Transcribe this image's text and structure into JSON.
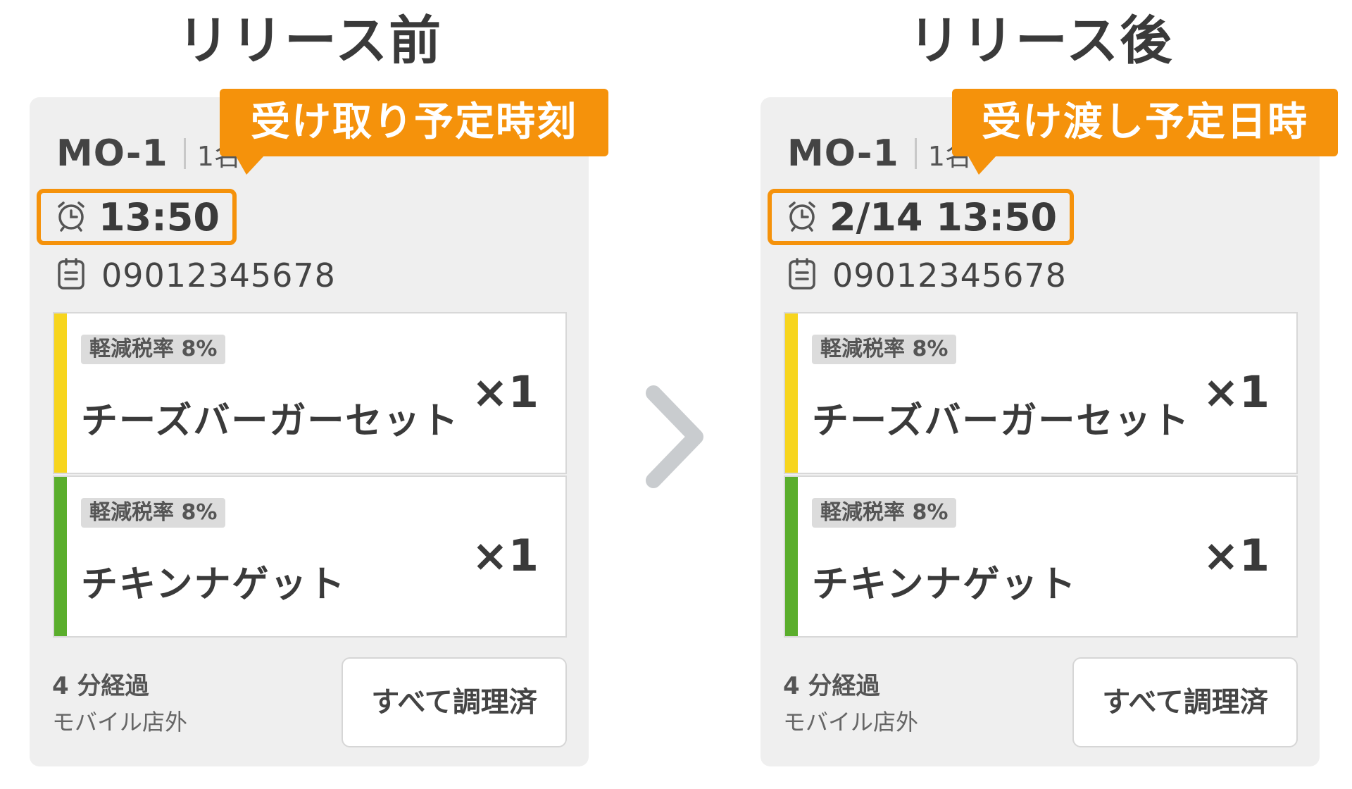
{
  "before": {
    "heading": "リリース前",
    "callout": "受け取り予定時刻",
    "card": {
      "order_id": "MO-1",
      "persons": "1名",
      "pickup_time": "13:50",
      "phone": "09012345678",
      "items": [
        {
          "tax_badge": "軽減税率 8%",
          "name": "チーズバーガーセット",
          "qty": "×1",
          "strip_color": "#f7d51d"
        },
        {
          "tax_badge": "軽減税率 8%",
          "name": "チキンナゲット",
          "qty": "×1",
          "strip_color": "#5aae2c"
        }
      ],
      "elapsed": "4 分経過",
      "channel": "モバイル店外",
      "cook_all_button": "すべて調理済"
    }
  },
  "after": {
    "heading": "リリース後",
    "callout": "受け渡し予定日時",
    "card": {
      "order_id": "MO-1",
      "persons": "1名",
      "pickup_time": "2/14 13:50",
      "phone": "09012345678",
      "items": [
        {
          "tax_badge": "軽減税率 8%",
          "name": "チーズバーガーセット",
          "qty": "×1",
          "strip_color": "#f7d51d"
        },
        {
          "tax_badge": "軽減税率 8%",
          "name": "チキンナゲット",
          "qty": "×1",
          "strip_color": "#5aae2c"
        }
      ],
      "elapsed": "4 分経過",
      "channel": "モバイル店外",
      "cook_all_button": "すべて調理済"
    }
  },
  "colors": {
    "accent": "#f5920b",
    "arrow": "#c9cccf",
    "card_bg": "#efefef"
  },
  "icons": {
    "clock": "alarm-clock-icon",
    "memo": "memo-icon",
    "arrow": "chevron-right-icon"
  }
}
